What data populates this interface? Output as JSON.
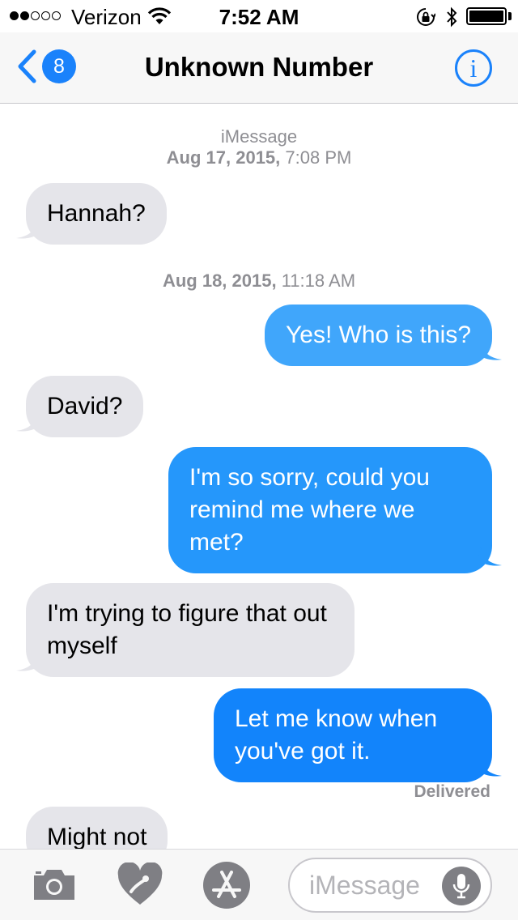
{
  "status_bar": {
    "carrier": "Verizon",
    "time": "7:52 AM",
    "signal_bars_filled": 2,
    "signal_bars_total": 5,
    "battery_level": 1.0
  },
  "nav": {
    "back_count": "8",
    "title": "Unknown Number",
    "info_glyph": "i"
  },
  "conversation": {
    "service_label": "iMessage",
    "timestamps": [
      {
        "date": "Aug 17, 2015,",
        "time": " 7:08 PM"
      },
      {
        "date": "Aug 18, 2015,",
        "time": " 11:18 AM"
      }
    ],
    "messages": [
      {
        "direction": "incoming",
        "text": "Hannah?"
      },
      {
        "direction": "outgoing",
        "text": "Yes! Who is this?",
        "color": "#40a6fb"
      },
      {
        "direction": "incoming",
        "text": "David?"
      },
      {
        "direction": "outgoing",
        "text": "I'm so sorry, could you remind me where we met?",
        "color": "#2597fb"
      },
      {
        "direction": "incoming",
        "text": "I'm trying to figure that out myself"
      },
      {
        "direction": "outgoing",
        "text": "Let me know when you've got it.",
        "color": "#1284fb"
      },
      {
        "direction": "incoming",
        "text": "Might not"
      }
    ],
    "delivery_status": "Delivered"
  },
  "input_bar": {
    "placeholder": "iMessage",
    "icons": [
      "camera-icon",
      "digital-touch-icon",
      "app-store-icon",
      "microphone-icon"
    ]
  },
  "colors": {
    "accent": "#1a82fb",
    "incoming_bubble": "#e5e5ea",
    "secondary_text": "#8e8e93"
  }
}
